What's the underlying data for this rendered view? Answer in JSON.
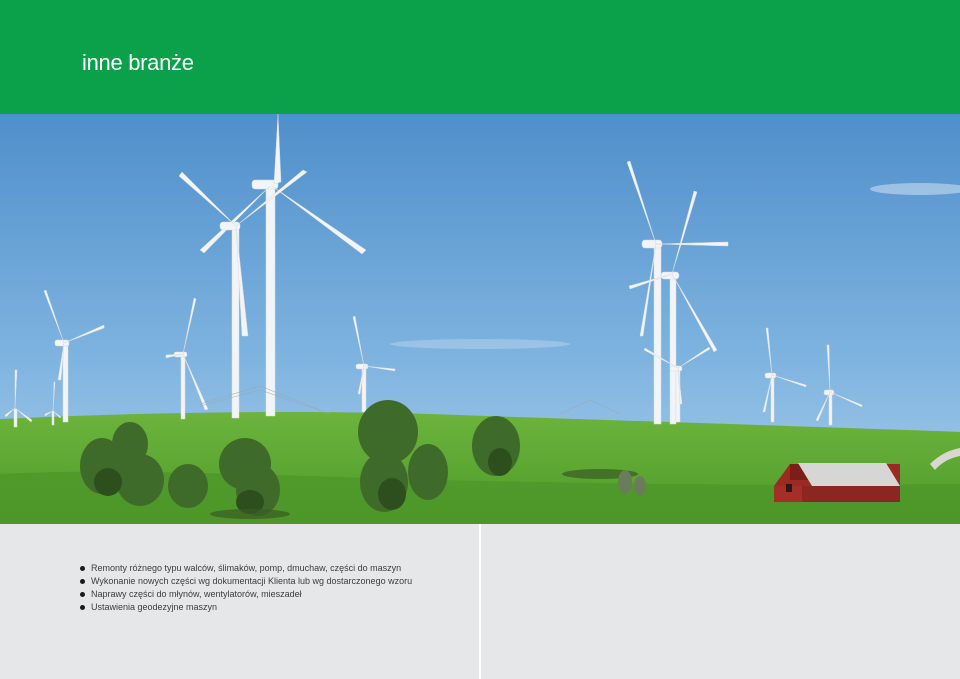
{
  "header": {
    "title": "inne branże",
    "color": "#0aa14a"
  },
  "photo": {
    "subject": "wind-turbines-on-green-hills",
    "colors": {
      "sky": "#5f9fd6",
      "grass": "#5aa832",
      "barn": "#9a2a22"
    }
  },
  "services": [
    {
      "text": "Remonty różnego typu walców, ślimaków, pomp, dmuchaw, części do maszyn"
    },
    {
      "text": "Wykonanie nowych części wg dokumentacji Klienta lub wg dostarczonego wzoru"
    },
    {
      "text": "Naprawy części do młynów, wentylatorów, mieszadeł"
    },
    {
      "text": "Ustawienia geodezyjne maszyn"
    }
  ]
}
